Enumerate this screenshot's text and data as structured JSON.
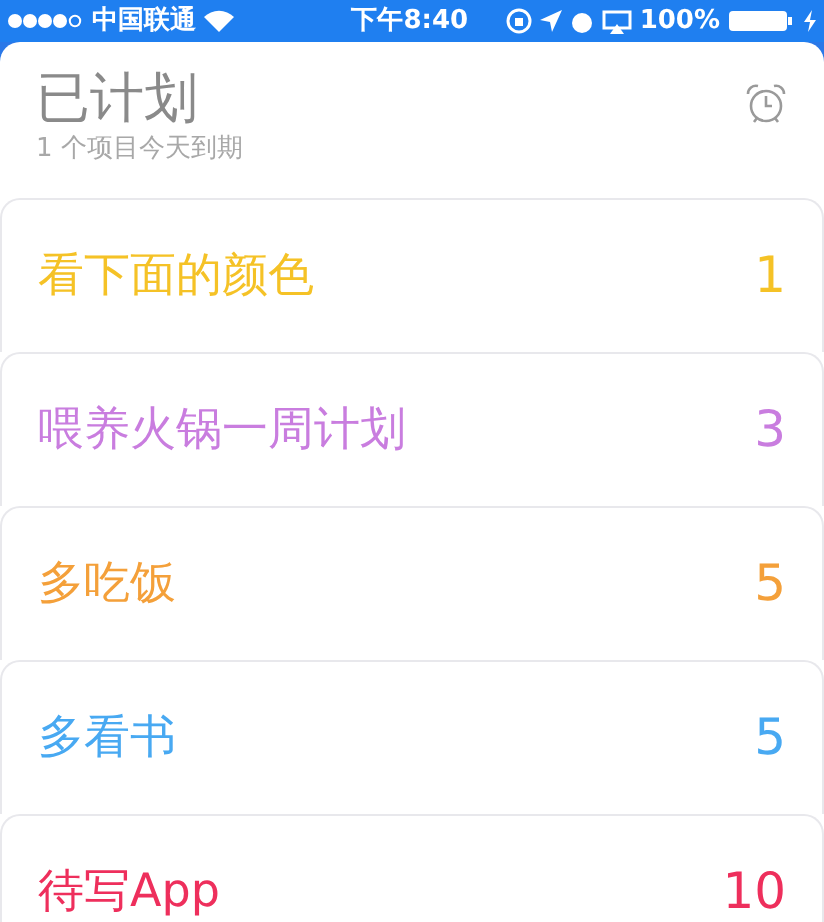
{
  "status_bar": {
    "carrier": "中国联通",
    "time": "下午8:40",
    "battery": "100%"
  },
  "header": {
    "title": "已计划",
    "subtitle": "1 个项目今天到期"
  },
  "lists": [
    {
      "name": "看下面的颜色",
      "count": "1",
      "color": "#f5c226"
    },
    {
      "name": "喂养火锅一周计划",
      "count": "3",
      "color": "#c97ddf"
    },
    {
      "name": "多吃饭",
      "count": "5",
      "color": "#f4a03a"
    },
    {
      "name": "多看书",
      "count": "5",
      "color": "#48a9f2"
    },
    {
      "name": "待写App",
      "count": "10",
      "color": "#ee2f5c"
    }
  ]
}
